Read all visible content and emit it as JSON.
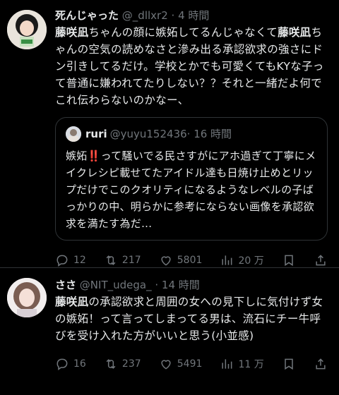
{
  "tweet1": {
    "display_name": "死んじゃった",
    "handle": "@_dllxr2",
    "time": "· 4 時間",
    "text": [
      {
        "t": "藤咲凪",
        "b": true
      },
      {
        "t": "ちゃんの顔に嫉妬してるんじゃなくて",
        "b": false
      },
      {
        "t": "藤咲凪",
        "b": true
      },
      {
        "t": "ちゃんの空気の読めなさと滲み出る承認欲求の強さにドン引きしてるだけ。学校とかでも可愛くてもKYな子って普通に嫌われてたりしない？？それと一緒だよ何でこれ伝わらないのかなー、",
        "b": false
      }
    ],
    "quote": {
      "display_name": "ruri",
      "handle": "@yuyu152436",
      "time": "· 16 時間",
      "text": "嫉妬‼️って騒いでる民さすがにアホ過ぎて丁寧にメイクレシピ載せてたアイドル達も日焼け止めとリップだけでこのクオリティになるようなレベルの子ばっかりの中、明らかに参考にならない画像を承認欲求を満たす為だ..."
    },
    "actions": {
      "replies": "12",
      "retweets": "217",
      "likes": "5801",
      "views": "20 万"
    }
  },
  "tweet2": {
    "display_name": "ささ",
    "handle": "@NIT_udega_",
    "time": "· 14 時間",
    "text": [
      {
        "t": "藤咲凪",
        "b": true
      },
      {
        "t": "の承認欲求と周囲の女への見下しに気付けず女の嫉妬！って言ってしまってる男は、流石にチー牛呼びを受け入れた方がいいと思う(小並感)",
        "b": false
      }
    ],
    "actions": {
      "replies": "16",
      "retweets": "237",
      "likes": "5491",
      "views": "11 万"
    }
  },
  "icons": {
    "reply": "reply-icon",
    "retweet": "retweet-icon",
    "like": "heart-icon",
    "views": "views-icon",
    "bookmark": "bookmark-icon",
    "share": "share-icon"
  }
}
